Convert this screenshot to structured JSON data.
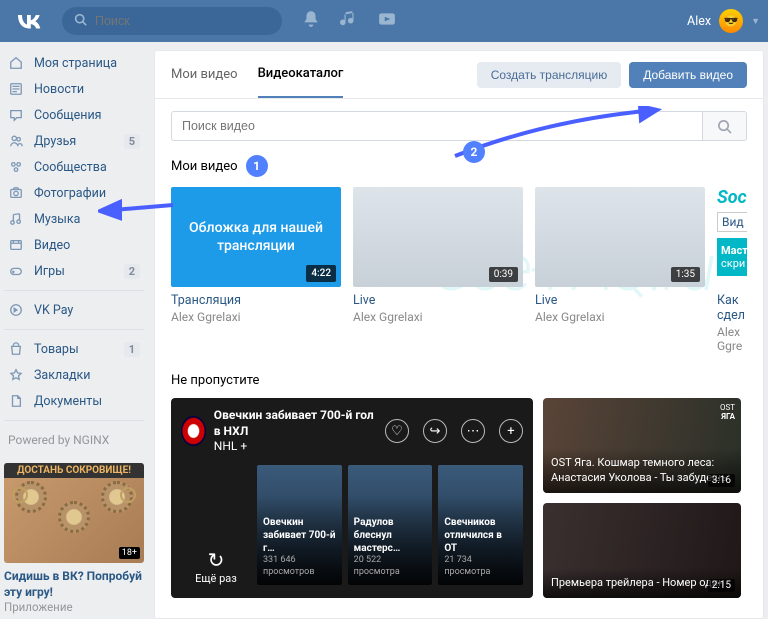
{
  "header": {
    "search_placeholder": "Поиск",
    "username": "Alex"
  },
  "sidebar": {
    "items": [
      {
        "label": "Моя страница"
      },
      {
        "label": "Новости"
      },
      {
        "label": "Сообщения"
      },
      {
        "label": "Друзья",
        "badge": "5"
      },
      {
        "label": "Сообщества"
      },
      {
        "label": "Фотографии"
      },
      {
        "label": "Музыка"
      },
      {
        "label": "Видео"
      },
      {
        "label": "Игры",
        "badge": "2"
      }
    ],
    "vkpay": "VK Pay",
    "secondary": [
      {
        "label": "Товары",
        "badge": "1"
      },
      {
        "label": "Закладки"
      },
      {
        "label": "Документы"
      }
    ],
    "powered": "Powered by NGINX",
    "promo": {
      "banner": "ДОСТАНЬ СОКРОВИЩЕ!",
      "age": "18+",
      "title": "Сидишь в ВК? Попробуй эту игру!",
      "subtitle": "Приложение"
    }
  },
  "tabs": {
    "my": "Мои видео",
    "catalog": "Видеокаталог"
  },
  "buttons": {
    "create_stream": "Создать трансляцию",
    "add_video": "Добавить видео"
  },
  "search": {
    "placeholder": "Поиск видео"
  },
  "sections": {
    "my_videos": "Мои видео",
    "dont_miss": "Не пропустите"
  },
  "annotations": {
    "n1": "1",
    "n2": "2"
  },
  "videos": {
    "my": [
      {
        "title": "Трансляция",
        "author": "Alex Ggrelaxi",
        "duration": "4:22",
        "overlay": "Обложка для нашей трансляции"
      },
      {
        "title": "Live",
        "author": "Alex Ggrelaxi",
        "duration": "0:39"
      },
      {
        "title": "Live",
        "author": "Alex Ggrelaxi",
        "duration": "1:35"
      },
      {
        "title": "Как сдел",
        "author": "Alex Ggre",
        "soc": "Soc",
        "vidbox": "Вид",
        "band1": "Масте",
        "band2": "скри"
      }
    ]
  },
  "featured": {
    "main": {
      "title": "Овечкин забивает 700-й гол в НХЛ",
      "channel": "NHL",
      "add": "+",
      "replay": "Ещё раз"
    },
    "clips": [
      {
        "t": "Овечкин забивает 700-й г…",
        "v": "331 646 просмотров"
      },
      {
        "t": "Радулов блеснул мастерс…",
        "v": "20 522 просмотра"
      },
      {
        "t": "Свечников отличился в ОТ",
        "v": "21 734 просмотра"
      }
    ],
    "side": [
      {
        "title": "OST Яга. Кошмар темного леса: Анастасия Уколова - Ты забудешь",
        "dur": "3:16",
        "ost1": "OST",
        "ost2": "ЯГА"
      },
      {
        "title": "Премьера трейлера - Номер один",
        "dur": "2:15"
      }
    ]
  },
  "watermark": "See-FAQ.ru"
}
